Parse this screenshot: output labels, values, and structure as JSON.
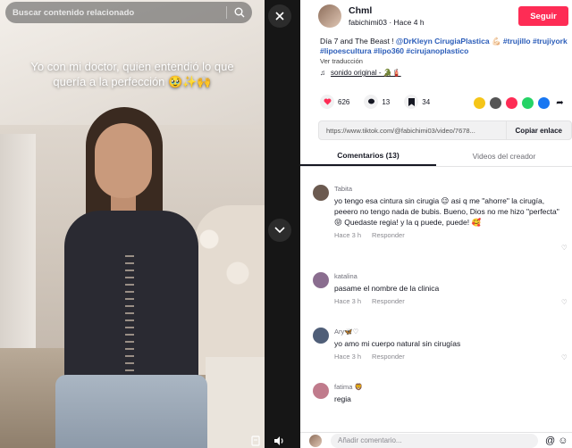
{
  "search": {
    "placeholder": "Buscar contenido relacionado",
    "icon": "search-icon"
  },
  "video": {
    "caption": "Yo con mi doctor, quien entendió lo que quería a la perfección 🥹✨🙌"
  },
  "post": {
    "author_name": "Chml",
    "author_meta": "fabichimi03 · Hace 4 h",
    "follow_label": "Seguir",
    "description_text": "Día 7 and The Beast ! ",
    "mention": "@DrKleyn CirugiaPlastica",
    "emoji": "💪🏻",
    "hashtags_line1": [
      "#trujillo",
      "#trujiyork"
    ],
    "hashtags_line2": [
      "#lipoescultura",
      "#lipo360",
      "#cirujanoplastico"
    ],
    "see_translation": "Ver traducción",
    "sound": "sonido original - 🐊🧯",
    "likes": "626",
    "comments": "13",
    "saves": "34",
    "link_url": "https://www.tiktok.com/@fabichimi03/video/7678...",
    "copy_link": "Copiar enlace"
  },
  "tabs": {
    "comments": "Comentarios (13)",
    "creator_videos": "Videos del creador"
  },
  "comments": [
    {
      "user": "Tabita",
      "text": "yo tengo esa cintura sin cirugia 😉 asi q me \"ahorre\" la cirugía, peeero no tengo nada de bubis. Bueno, Dios no me hizo \"perfecta\" 😝 Quedaste regia! y la q puede, puede! 🥰",
      "time": "Hace 3 h",
      "reply": "Responder",
      "avatar_color": "#6b5a50"
    },
    {
      "user": "katalina",
      "text": "pasame el nombre de la clinica",
      "time": "Hace 3 h",
      "reply": "Responder",
      "avatar_color": "#8a6d8f"
    },
    {
      "user": "Ary🦋♡",
      "text": "yo amo mi cuerpo natural sin cirugías",
      "time": "Hace 3 h",
      "reply": "Responder",
      "avatar_color": "#4f5e78"
    },
    {
      "user": "fatima 🦁",
      "text": "regia",
      "time": "",
      "reply": "",
      "avatar_color": "#c07b8c"
    }
  ],
  "input": {
    "placeholder": "Añadir comentario...",
    "icons": "@ ☺"
  },
  "colors": {
    "accent": "#fe2c55",
    "link": "#2b5db9",
    "text": "#161823"
  }
}
